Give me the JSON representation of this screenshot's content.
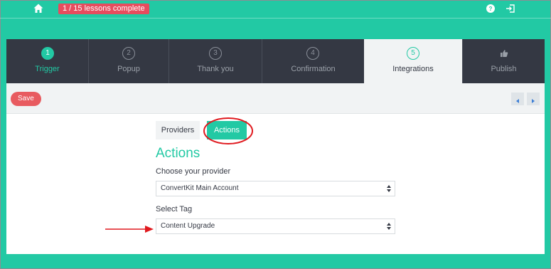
{
  "topbar": {
    "progress": "1 / 15 lessons complete",
    "icons": {
      "home": "home-icon",
      "help": "help-icon",
      "logout": "logout-icon"
    }
  },
  "steps": [
    {
      "number": "1",
      "label": "Trigger",
      "state": "done"
    },
    {
      "number": "2",
      "label": "Popup",
      "state": "pending"
    },
    {
      "number": "3",
      "label": "Thank you",
      "state": "pending"
    },
    {
      "number": "4",
      "label": "Confirmation",
      "state": "pending"
    },
    {
      "number": "5",
      "label": "Integrations",
      "state": "active"
    },
    {
      "number": "",
      "label": "Publish",
      "state": "pending",
      "icon": "thumbs-up-icon"
    }
  ],
  "toolbar": {
    "save_label": "Save",
    "prev_icon": "chevron-left-icon",
    "next_icon": "chevron-right-icon"
  },
  "tabs": {
    "providers": "Providers",
    "actions": "Actions",
    "active": "Actions"
  },
  "actions_form": {
    "title": "Actions",
    "provider_label": "Choose your provider",
    "provider_value": "ConvertKit Main Account",
    "tag_label": "Select Tag",
    "tag_value": "Content Upgrade"
  },
  "colors": {
    "accent": "#22c9a4",
    "danger": "#e85b60",
    "dark": "#343843",
    "annotation": "#e0191e"
  }
}
